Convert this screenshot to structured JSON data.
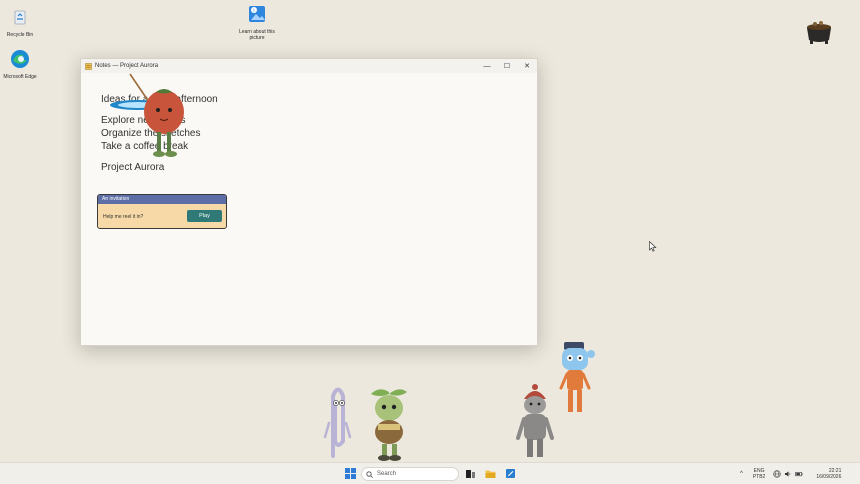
{
  "desktop": {
    "icons": [
      {
        "label": "Recycle Bin"
      },
      {
        "label": "Microsoft Edge"
      },
      {
        "label": "Learn about this picture"
      }
    ]
  },
  "window": {
    "title": "Notes — Project Aurora",
    "controls": {
      "minimize": "—",
      "maximize": "☐",
      "close": "✕"
    },
    "lines": [
      "Ideas for a quiet afternoon",
      "Explore new colors",
      "Organize the sketches",
      "Take a coffee break",
      "Project Aurora"
    ],
    "invitation": {
      "header": "An invitation",
      "message": "Help me reel it in?",
      "button": "Play"
    }
  },
  "taskbar": {
    "search_placeholder": "Search",
    "tray": {
      "lang_top": "ENG",
      "lang_bottom": "PTB2",
      "time": "22:21",
      "date": "16/09/2026"
    }
  },
  "colors": {
    "desktop_bg": "#ece8dd",
    "invitation_header": "#5d6ea6",
    "invitation_bg": "#f6d9a6",
    "play_button": "#2f7a76"
  }
}
